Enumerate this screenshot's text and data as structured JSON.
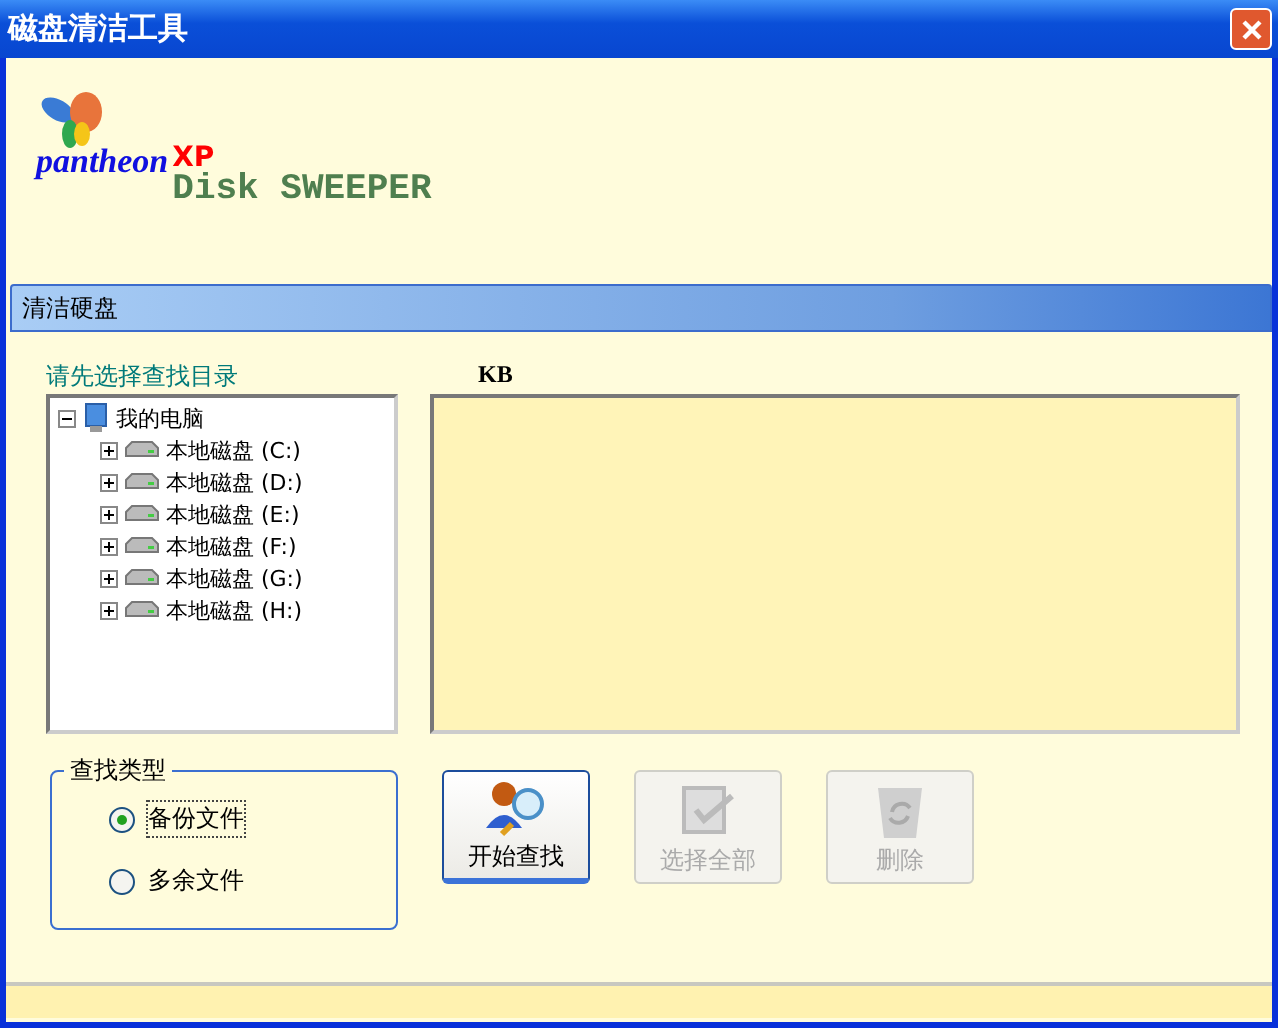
{
  "window": {
    "title": "磁盘清洁工具"
  },
  "logo": {
    "brand": "pantheon",
    "edition": "XP",
    "product": "Disk SWEEPER"
  },
  "section": {
    "title": "清洁硬盘"
  },
  "tree": {
    "label": "请先选择查找目录",
    "items": [
      {
        "label": "我的电脑",
        "kind": "computer",
        "expanded": true,
        "children": [
          {
            "label": "本地磁盘 (C:)",
            "kind": "drive",
            "expanded": false
          },
          {
            "label": "本地磁盘 (D:)",
            "kind": "drive",
            "expanded": false
          },
          {
            "label": "本地磁盘 (E:)",
            "kind": "drive",
            "expanded": false
          },
          {
            "label": "本地磁盘 (F:)",
            "kind": "drive",
            "expanded": false
          },
          {
            "label": "本地磁盘 (G:)",
            "kind": "drive",
            "expanded": false
          },
          {
            "label": "本地磁盘 (H:)",
            "kind": "drive",
            "expanded": false
          }
        ]
      }
    ]
  },
  "results": {
    "columns": [
      "KB"
    ]
  },
  "search_type": {
    "title": "查找类型",
    "options": [
      {
        "label": "备份文件",
        "selected": true
      },
      {
        "label": "多余文件",
        "selected": false
      }
    ]
  },
  "buttons": [
    {
      "label": "开始查找",
      "kind": "search",
      "disabled": false
    },
    {
      "label": "选择全部",
      "kind": "selectall",
      "disabled": true
    },
    {
      "label": "删除",
      "kind": "delete",
      "disabled": true
    }
  ]
}
